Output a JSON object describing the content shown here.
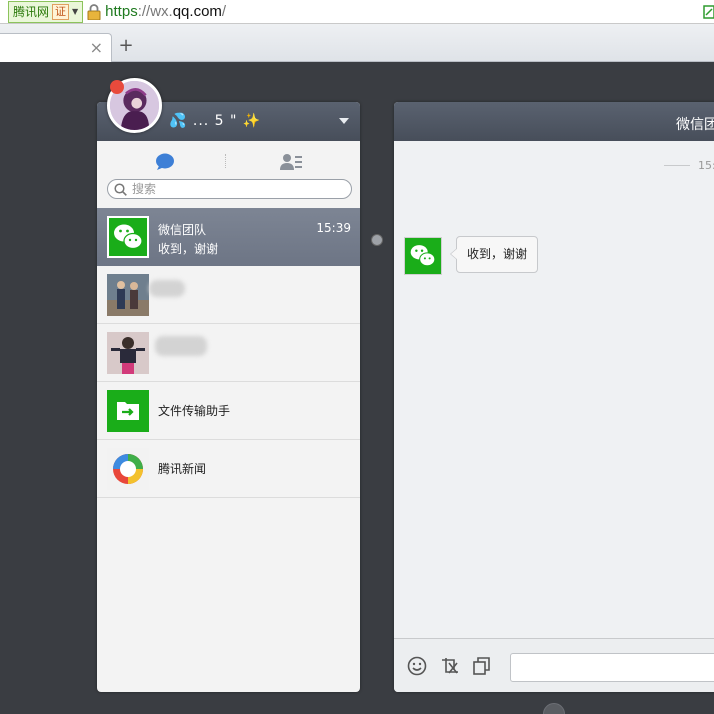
{
  "browser": {
    "site_label": "腾讯网",
    "cert_label": "证",
    "url_scheme": "https",
    "url_sep": "://",
    "url_sub": "wx.",
    "url_domain": "qq.com",
    "url_path": "/",
    "tab_close": "×",
    "new_tab": "+"
  },
  "profile": {
    "nickname": "💦 ... 5 \" ✨"
  },
  "search": {
    "placeholder": "搜索"
  },
  "conversations": [
    {
      "name": "微信团队",
      "preview": "收到，谢谢",
      "time": "15:39",
      "active": true
    },
    {
      "name": "",
      "preview": "",
      "time": ""
    },
    {
      "name": "",
      "preview": "",
      "time": ""
    },
    {
      "name": "文件传输助手",
      "preview": "",
      "time": ""
    },
    {
      "name": "腾讯新闻",
      "preview": "",
      "time": ""
    }
  ],
  "chat": {
    "title": "微信团",
    "time_label": "15:",
    "messages": [
      {
        "text": "收到，谢谢"
      }
    ]
  },
  "colors": {
    "wechat_green": "#1aad19",
    "panel_header": "#4f5663",
    "active_row": "#757d8c"
  }
}
